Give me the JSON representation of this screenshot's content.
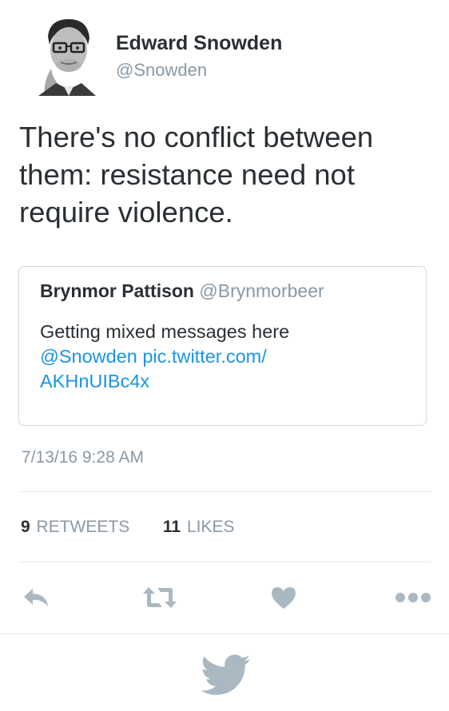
{
  "author": {
    "name": "Edward Snowden",
    "handle": "@Snowden",
    "avatar_icon": "avatar-photo"
  },
  "tweet": {
    "text": "There's no conflict between them: resistance need not require violence.",
    "timestamp": "7/13/16 9:28 AM"
  },
  "quoted_tweet": {
    "name": "Brynmor Pattison",
    "handle": "@Brynmorbeer",
    "text": "Getting mixed messages here",
    "mention": "@Snowden",
    "link_part1": "pic.twitter.com/",
    "link_part2": "AKHnUIBc4x"
  },
  "stats": {
    "retweets_count": "9",
    "retweets_label": "RETWEETS",
    "likes_count": "11",
    "likes_label": "LIKES"
  },
  "actions": [
    {
      "name": "reply",
      "icon": "reply-icon"
    },
    {
      "name": "retweet",
      "icon": "retweet-icon"
    },
    {
      "name": "like",
      "icon": "heart-icon"
    },
    {
      "name": "more",
      "icon": "more-icon"
    }
  ],
  "colors": {
    "text": "#292f33",
    "secondary": "#8899a6",
    "link": "#1b95e0",
    "divider": "#e1e8ed",
    "icon": "#aab8c2"
  }
}
